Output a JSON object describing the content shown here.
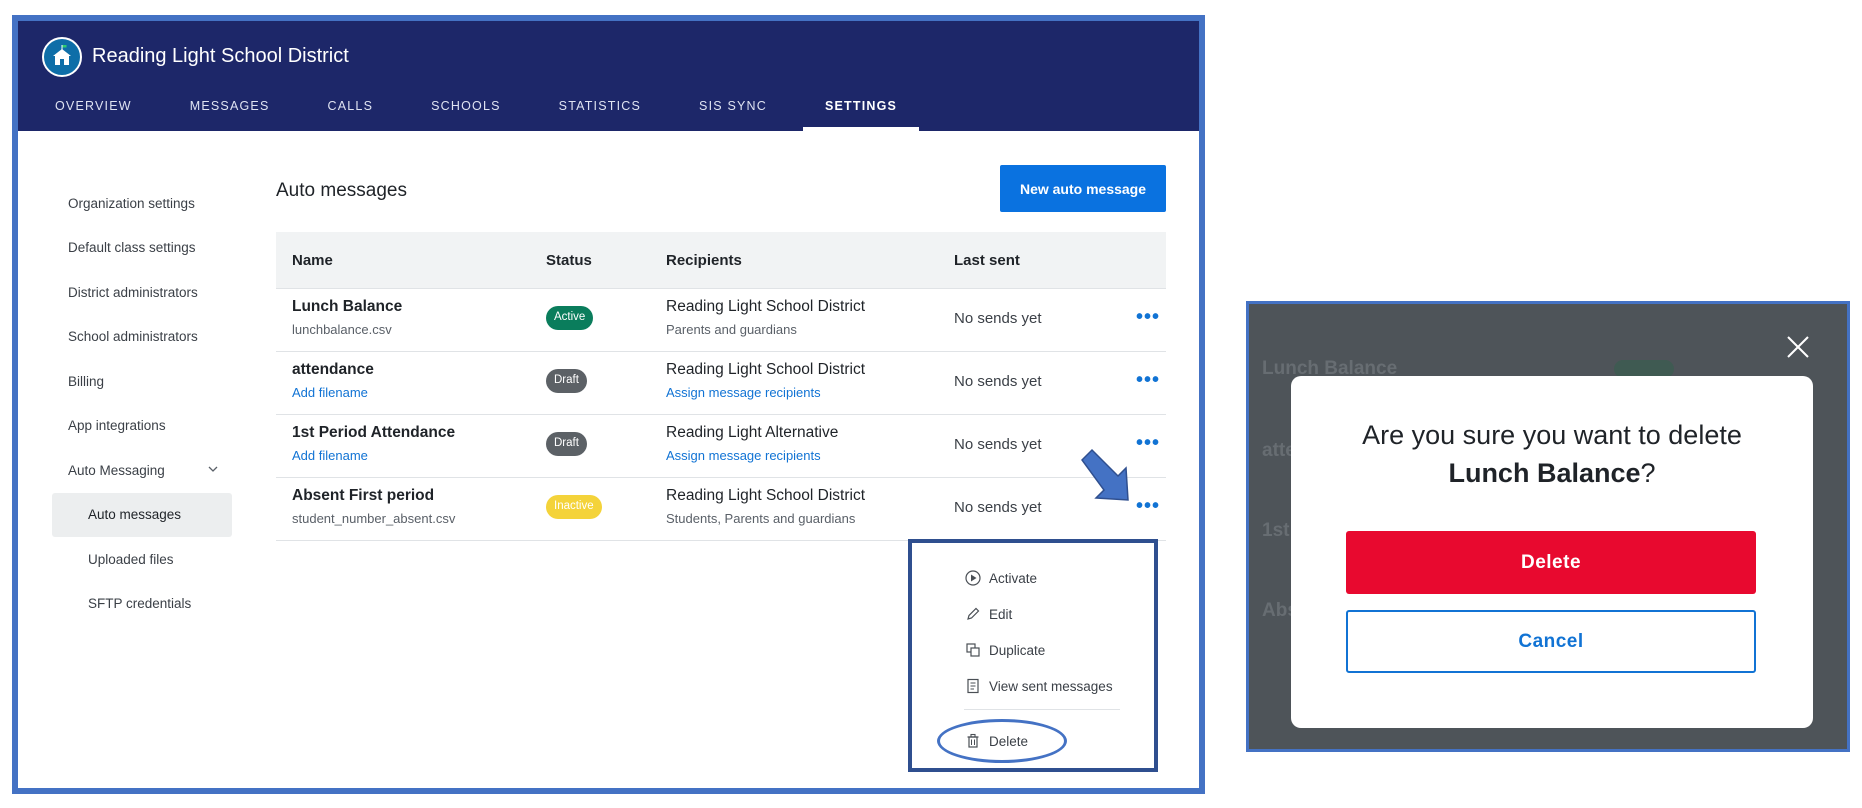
{
  "app": {
    "org_name": "Reading Light School District"
  },
  "nav": {
    "tabs": [
      {
        "label": "OVERVIEW"
      },
      {
        "label": "MESSAGES"
      },
      {
        "label": "CALLS"
      },
      {
        "label": "SCHOOLS"
      },
      {
        "label": "STATISTICS"
      },
      {
        "label": "SIS SYNC"
      },
      {
        "label": "SETTINGS",
        "active": true
      }
    ]
  },
  "sidebar": {
    "items": [
      {
        "label": "Organization settings"
      },
      {
        "label": "Default class settings"
      },
      {
        "label": "District administrators"
      },
      {
        "label": "School administrators"
      },
      {
        "label": "Billing"
      },
      {
        "label": "App integrations"
      },
      {
        "label": "Auto Messaging",
        "expanded": true
      },
      {
        "label": "Auto messages",
        "selected": true
      },
      {
        "label": "Uploaded files"
      },
      {
        "label": "SFTP credentials"
      }
    ]
  },
  "main": {
    "title": "Auto messages",
    "new_button": "New auto message",
    "columns": [
      "Name",
      "Status",
      "Recipients",
      "Last sent"
    ],
    "rows": [
      {
        "name": "Lunch Balance",
        "file": "lunchbalance.csv",
        "file_is_link": false,
        "status": "Active",
        "status_color": "#0a7d5c",
        "recipient": "Reading Light School District",
        "recipient_sub": "Parents and guardians",
        "recipient_sub_is_link": false,
        "last_sent": "No sends yet"
      },
      {
        "name": "attendance",
        "file": "Add filename",
        "file_is_link": true,
        "status": "Draft",
        "status_color": "#5c6166",
        "recipient": "Reading Light School District",
        "recipient_sub": "Assign message recipients",
        "recipient_sub_is_link": true,
        "last_sent": "No sends yet"
      },
      {
        "name": "1st Period Attendance",
        "file": "Add filename",
        "file_is_link": true,
        "status": "Draft",
        "status_color": "#5c6166",
        "recipient": "Reading Light Alternative",
        "recipient_sub": "Assign message recipients",
        "recipient_sub_is_link": true,
        "last_sent": "No sends yet"
      },
      {
        "name": "Absent First period",
        "file": "student_number_absent.csv",
        "file_is_link": false,
        "status": "Inactive",
        "status_color": "#f4d33a",
        "recipient": "Reading Light School District",
        "recipient_sub": "Students, Parents and guardians",
        "recipient_sub_is_link": false,
        "last_sent": "No sends yet"
      }
    ],
    "more_label": "•••"
  },
  "menu": {
    "items": [
      {
        "label": "Activate",
        "icon": "play-circle-icon"
      },
      {
        "label": "Edit",
        "icon": "pencil-icon"
      },
      {
        "label": "Duplicate",
        "icon": "duplicate-icon"
      },
      {
        "label": "View sent messages",
        "icon": "document-icon"
      },
      {
        "label": "Delete",
        "icon": "trash-icon"
      }
    ]
  },
  "dialog": {
    "question": "Are you sure you want to delete",
    "item_name": "Lunch Balance",
    "question_end": "?",
    "delete_label": "Delete",
    "cancel_label": "Cancel"
  },
  "colors": {
    "topbar": "#1d2769",
    "primary_button": "#0a72e0",
    "link": "#1173d4",
    "delete_button": "#e8092f",
    "annotation": "#4472c4"
  }
}
